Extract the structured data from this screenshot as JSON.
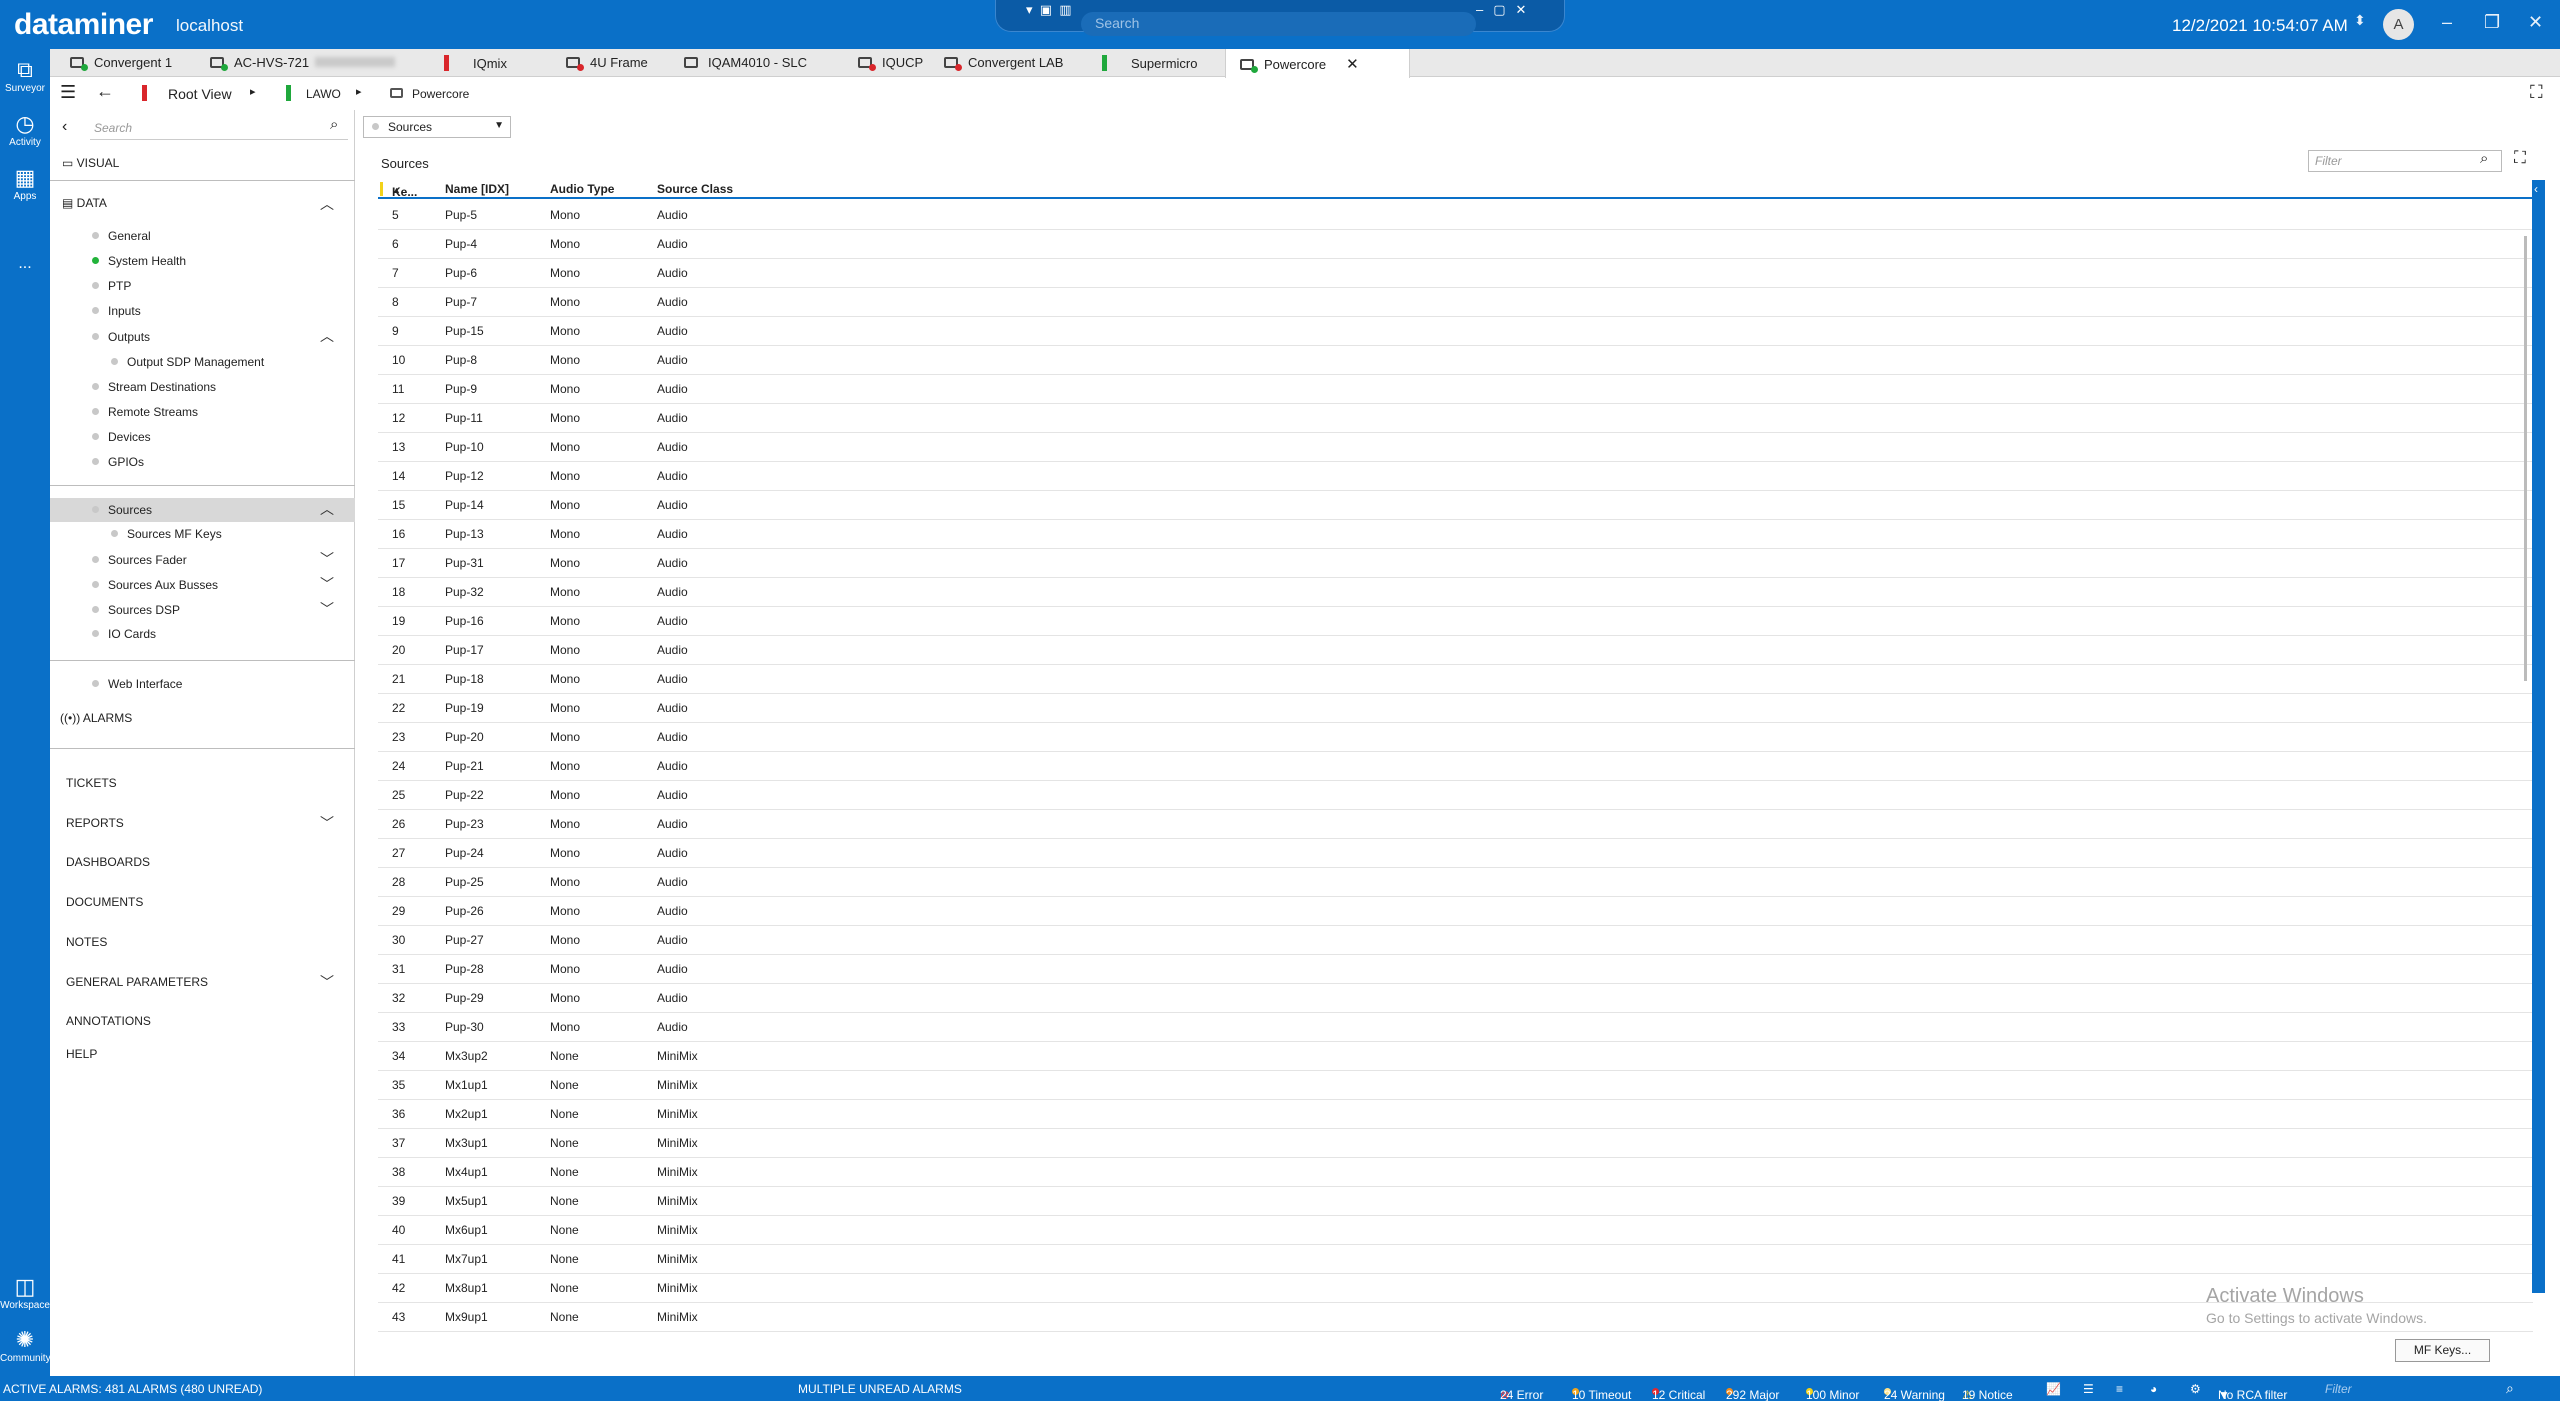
{
  "app": {
    "brand": "dataminer",
    "host": "localhost",
    "clock": "12/2/2021 10:54:07 AM",
    "avatar": "A",
    "center_search_placeholder": "Search"
  },
  "sidebar": [
    {
      "label": "Surveyor",
      "icon": "surveyor-icon"
    },
    {
      "label": "Activity",
      "icon": "activity-icon"
    },
    {
      "label": "Apps",
      "icon": "apps-icon"
    },
    {
      "label": "...",
      "icon": "more-icon"
    },
    {
      "label": "Workspace",
      "icon": "workspace-icon"
    },
    {
      "label": "Community",
      "icon": "community-icon"
    }
  ],
  "tabs": [
    {
      "label": "Convergent 1",
      "status": "green"
    },
    {
      "label": "AC-HVS-721",
      "status": "green"
    },
    {
      "label": "IQmix",
      "status": "red-flag"
    },
    {
      "label": "4U Frame",
      "status": "red"
    },
    {
      "label": "IQAM4010 - SLC",
      "status": "none"
    },
    {
      "label": "IQUCP",
      "status": "red"
    },
    {
      "label": "Convergent LAB",
      "status": "red"
    },
    {
      "label": "Supermicro",
      "status": "green-flag"
    },
    {
      "label": "Powercore",
      "status": "green"
    }
  ],
  "breadcrumb": {
    "root": "Root View",
    "level1": "LAWO",
    "level2": "Powercore"
  },
  "nav": {
    "search_placeholder": "Search",
    "visual": "VISUAL",
    "data": "DATA",
    "items": [
      "General",
      "System Health",
      "PTP",
      "Inputs",
      "Outputs",
      "Output SDP Management",
      "Stream Destinations",
      "Remote Streams",
      "Devices",
      "GPIOs",
      "Sources",
      "Sources MF Keys",
      "Sources Fader",
      "Sources Aux Busses",
      "Sources DSP",
      "IO Cards",
      "Web Interface"
    ],
    "alarms": "ALARMS",
    "sections": [
      "TICKETS",
      "REPORTS",
      "DASHBOARDS",
      "DOCUMENTS",
      "NOTES",
      "GENERAL PARAMETERS",
      "ANNOTATIONS",
      "HELP"
    ]
  },
  "main": {
    "dropdown": "Sources",
    "table_title": "Sources",
    "filter_placeholder": "Filter",
    "columns": [
      "Ke...",
      "Name [IDX]",
      "Audio Type",
      "Source Class"
    ],
    "rows": [
      [
        "5",
        "Pup-5",
        "Mono",
        "Audio"
      ],
      [
        "6",
        "Pup-4",
        "Mono",
        "Audio"
      ],
      [
        "7",
        "Pup-6",
        "Mono",
        "Audio"
      ],
      [
        "8",
        "Pup-7",
        "Mono",
        "Audio"
      ],
      [
        "9",
        "Pup-15",
        "Mono",
        "Audio"
      ],
      [
        "10",
        "Pup-8",
        "Mono",
        "Audio"
      ],
      [
        "11",
        "Pup-9",
        "Mono",
        "Audio"
      ],
      [
        "12",
        "Pup-11",
        "Mono",
        "Audio"
      ],
      [
        "13",
        "Pup-10",
        "Mono",
        "Audio"
      ],
      [
        "14",
        "Pup-12",
        "Mono",
        "Audio"
      ],
      [
        "15",
        "Pup-14",
        "Mono",
        "Audio"
      ],
      [
        "16",
        "Pup-13",
        "Mono",
        "Audio"
      ],
      [
        "17",
        "Pup-31",
        "Mono",
        "Audio"
      ],
      [
        "18",
        "Pup-32",
        "Mono",
        "Audio"
      ],
      [
        "19",
        "Pup-16",
        "Mono",
        "Audio"
      ],
      [
        "20",
        "Pup-17",
        "Mono",
        "Audio"
      ],
      [
        "21",
        "Pup-18",
        "Mono",
        "Audio"
      ],
      [
        "22",
        "Pup-19",
        "Mono",
        "Audio"
      ],
      [
        "23",
        "Pup-20",
        "Mono",
        "Audio"
      ],
      [
        "24",
        "Pup-21",
        "Mono",
        "Audio"
      ],
      [
        "25",
        "Pup-22",
        "Mono",
        "Audio"
      ],
      [
        "26",
        "Pup-23",
        "Mono",
        "Audio"
      ],
      [
        "27",
        "Pup-24",
        "Mono",
        "Audio"
      ],
      [
        "28",
        "Pup-25",
        "Mono",
        "Audio"
      ],
      [
        "29",
        "Pup-26",
        "Mono",
        "Audio"
      ],
      [
        "30",
        "Pup-27",
        "Mono",
        "Audio"
      ],
      [
        "31",
        "Pup-28",
        "Mono",
        "Audio"
      ],
      [
        "32",
        "Pup-29",
        "Mono",
        "Audio"
      ],
      [
        "33",
        "Pup-30",
        "Mono",
        "Audio"
      ],
      [
        "34",
        "Mx3up2",
        "None",
        "MiniMix"
      ],
      [
        "35",
        "Mx1up1",
        "None",
        "MiniMix"
      ],
      [
        "36",
        "Mx2up1",
        "None",
        "MiniMix"
      ],
      [
        "37",
        "Mx3up1",
        "None",
        "MiniMix"
      ],
      [
        "38",
        "Mx4up1",
        "None",
        "MiniMix"
      ],
      [
        "39",
        "Mx5up1",
        "None",
        "MiniMix"
      ],
      [
        "40",
        "Mx6up1",
        "None",
        "MiniMix"
      ],
      [
        "41",
        "Mx7up1",
        "None",
        "MiniMix"
      ],
      [
        "42",
        "Mx8up1",
        "None",
        "MiniMix"
      ],
      [
        "43",
        "Mx9up1",
        "None",
        "MiniMix"
      ]
    ],
    "mf_keys_button": "MF Keys...",
    "watermark_title": "Activate Windows",
    "watermark_sub": "Go to Settings to activate Windows."
  },
  "status": {
    "active_alarms": "ACTIVE ALARMS: 481 ALARMS (480 UNREAD)",
    "unread": "MULTIPLE UNREAD ALARMS",
    "counts": [
      {
        "label": "24 Error",
        "color": "#e0282e"
      },
      {
        "label": "10 Timeout",
        "color": "#f2a51a"
      },
      {
        "label": "12 Critical",
        "color": "#e0282e"
      },
      {
        "label": "292 Major",
        "color": "#f28a1a"
      },
      {
        "label": "100 Minor",
        "color": "#f2d21a"
      },
      {
        "label": "24 Warning",
        "color": "#ffe38a"
      },
      {
        "label": "19 Notice",
        "color": "#f2c21a"
      }
    ],
    "rca": "No RCA filter",
    "filter_placeholder": "Filter"
  }
}
